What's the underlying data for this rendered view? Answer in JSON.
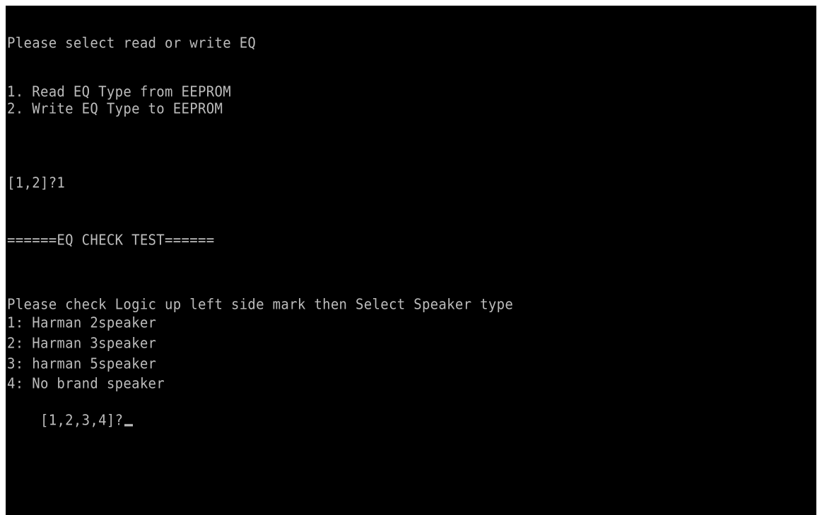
{
  "console": {
    "menu_title": "Please select read or write EQ",
    "options": [
      "1. Read EQ Type from EEPROM",
      "2. Write EQ Type to EEPROM"
    ],
    "first_prompt": "[1,2]?1",
    "test_banner": "======EQ CHECK TEST======",
    "instruction": "Please check Logic up left side mark then Select Speaker type",
    "speakers": [
      "1: Harman 2speaker",
      "2: Harman 3speaker",
      "3: harman 5speaker",
      "4: No brand speaker"
    ],
    "second_prompt": "[1,2,3,4]?",
    "cursor": "_"
  },
  "colors": {
    "background": "#000000",
    "text": "#bcbcbc"
  }
}
